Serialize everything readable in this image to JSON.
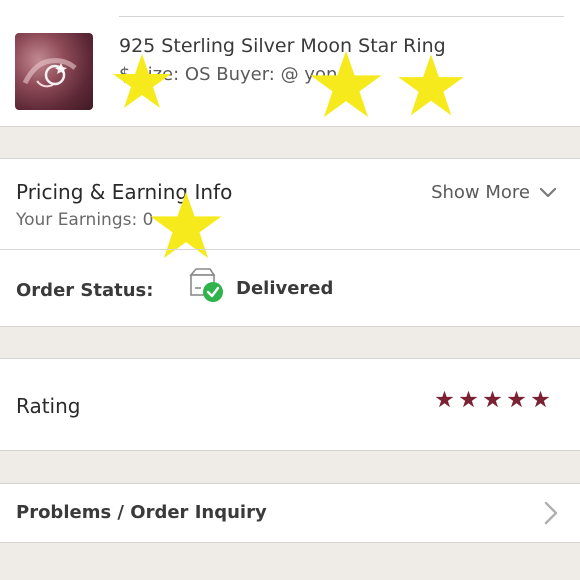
{
  "item": {
    "title": "925 Sterling Silver Moon Star Ring",
    "meta": "$   Size: OS   Buyer: @         yone"
  },
  "pricing": {
    "title": "Pricing & Earning Info",
    "show_more": "Show More",
    "earnings": "Your Earnings:              0"
  },
  "order_status": {
    "label": "Order Status:",
    "value": "Delivered"
  },
  "rating": {
    "label": "Rating",
    "value": 5,
    "max": 5,
    "star_color": "#7a2233"
  },
  "problems": {
    "label": "Problems / Order Inquiry"
  },
  "overlay_star_color": "#f6ea1c",
  "icons": {
    "show_more": "chevron-down-icon",
    "status": "package-delivered-icon",
    "problems": "chevron-right-icon"
  }
}
